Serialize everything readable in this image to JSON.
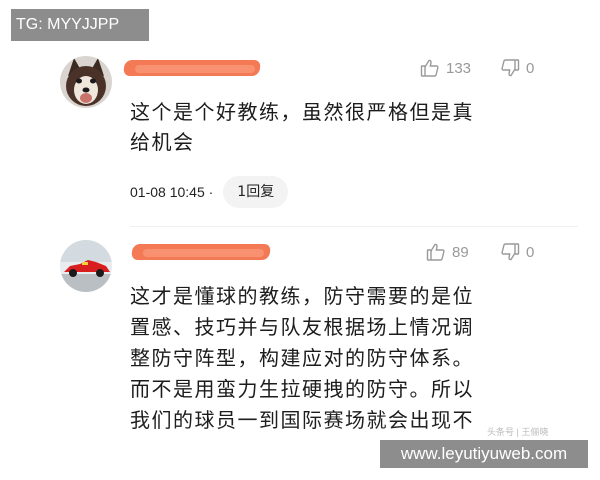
{
  "overlay": {
    "tg_label": "TG: MYYJJPP",
    "site_label": "www.leyutiyuweb.com",
    "small_mark": "头条号 | 王俪晓"
  },
  "comments": [
    {
      "avatar_icon": "husky-dog-avatar",
      "like_count": "133",
      "dislike_count": "0",
      "text": "这个是个好教练，虽然很严格但是真\n给机会",
      "timestamp": "01-08 10:45 ·",
      "reply_label": "1回复"
    },
    {
      "avatar_icon": "red-race-car-avatar",
      "like_count": "89",
      "dislike_count": "0",
      "text": "这才是懂球的教练，防守需要的是位\n置感、技巧并与队友根据场上情况调\n整防守阵型，构建应对的防守体系。\n而不是用蛮力生拉硬拽的防守。所以\n我们的球员一到国际赛场就会出现不"
    }
  ],
  "colors": {
    "redaction": "#f47a55",
    "icon_gray": "#999999",
    "reply_bg": "#f3f3f3",
    "badge_bg": "#8d8d8d"
  }
}
